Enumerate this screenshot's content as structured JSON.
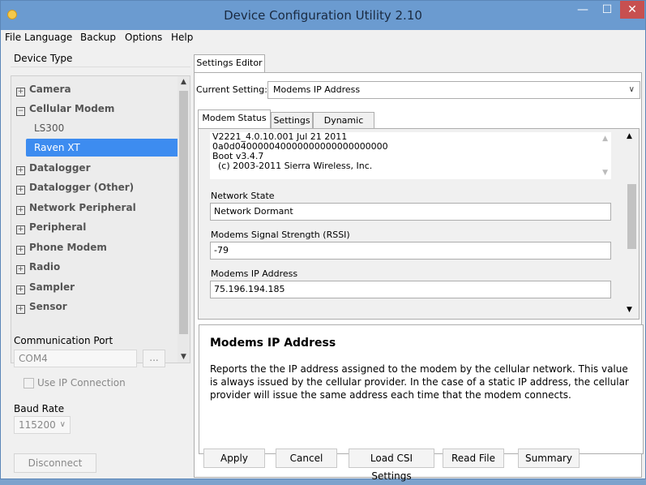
{
  "window": {
    "title": "Device Configuration Utility 2.10",
    "minimize": "—",
    "maximize": "☐",
    "close": "✕"
  },
  "menu": [
    "File",
    "Language",
    "Backup",
    "Options",
    "Help"
  ],
  "left": {
    "device_type_header": "Device Type",
    "tree": [
      {
        "label": "Camera",
        "expanded": false
      },
      {
        "label": "Cellular Modem",
        "expanded": true
      },
      {
        "label": "Datalogger",
        "expanded": false
      },
      {
        "label": "Datalogger (Other)",
        "expanded": false
      },
      {
        "label": "Network Peripheral",
        "expanded": false
      },
      {
        "label": "Peripheral",
        "expanded": false
      },
      {
        "label": "Phone Modem",
        "expanded": false
      },
      {
        "label": "Radio",
        "expanded": false
      },
      {
        "label": "Sampler",
        "expanded": false
      },
      {
        "label": "Sensor",
        "expanded": false
      }
    ],
    "children": [
      "LS300",
      "Raven XT"
    ],
    "selected_child": "Raven XT",
    "plus": "+",
    "minus": "−",
    "comm_port_label": "Communication Port",
    "comm_port_value": "COM4",
    "browse_label": "...",
    "use_ip_label": "Use IP Connection",
    "baud_rate_label": "Baud Rate",
    "baud_rate_value": "115200",
    "disconnect_label": "Disconnect"
  },
  "right": {
    "editor_tab": "Settings Editor",
    "current_setting_label": "Current Setting:",
    "current_setting_value": "Modems IP Address",
    "tabs": [
      "Modem Status",
      "Settings",
      "Dynamic DNS"
    ],
    "status_lines": [
      "V2221_4.0.10.001 Jul 21 2011",
      "0a0d040000040000000000000000000",
      "Boot v3.4.7",
      "  (c) 2003-2011 Sierra Wireless, Inc."
    ],
    "fields": [
      {
        "label": "Network State",
        "value": "Network Dormant"
      },
      {
        "label": "Modems Signal Strength (RSSI)",
        "value": "-79"
      },
      {
        "label": "Modems IP Address",
        "value": "75.196.194.185"
      }
    ],
    "help_title": "Modems IP Address",
    "help_text": "Reports the the IP address assigned to the modem by the cellular network. This value is always issued by the cellular provider. In the case of a static IP address, the cellular provider will issue the same address each time that the modem connects.",
    "buttons": [
      "Apply",
      "Cancel",
      "Load CSI Settings",
      "Read File",
      "Summary"
    ]
  }
}
